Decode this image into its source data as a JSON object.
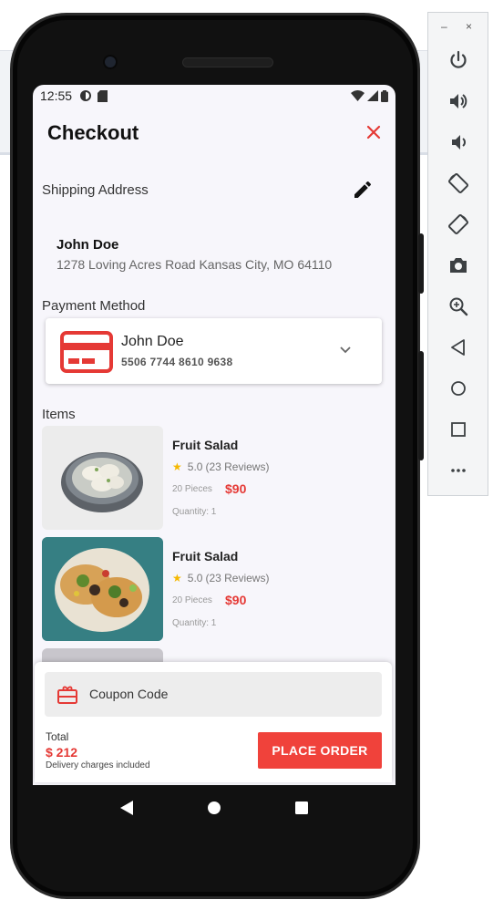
{
  "status_bar": {
    "time": "12:55"
  },
  "header": {
    "title": "Checkout"
  },
  "shipping": {
    "label": "Shipping Address",
    "name": "John Doe",
    "address": "1278 Loving Acres Road Kansas City, MO 64110"
  },
  "payment": {
    "label": "Payment Method",
    "holder": "John Doe",
    "card_number": "5506 7744 8610 9638"
  },
  "items": {
    "label": "Items",
    "list": [
      {
        "name": "Fruit Salad",
        "rating": "5.0",
        "reviews": "(23 Reviews)",
        "pieces": "20 Pieces",
        "price": "$90",
        "quantity": "Quantity: 1"
      },
      {
        "name": "Fruit Salad",
        "rating": "5.0",
        "reviews": "(23 Reviews)",
        "pieces": "20 Pieces",
        "price": "$90",
        "quantity": "Quantity: 1"
      }
    ]
  },
  "coupon": {
    "label": "Coupon Code"
  },
  "summary": {
    "total_label": "Total",
    "total_value": "$ 212",
    "note": "Delivery charges included",
    "place_order": "PLACE ORDER"
  },
  "colors": {
    "accent": "#e53935",
    "button": "#f0423b",
    "star": "#f5b800",
    "screen_bg": "#f7f6fb"
  },
  "emulator_toolbar": {
    "window_controls": [
      "–",
      "×"
    ],
    "tools": [
      "power-icon",
      "volume-up-icon",
      "volume-down-icon",
      "rotate-left-icon",
      "rotate-right-icon",
      "camera-icon",
      "zoom-icon",
      "back-icon",
      "home-icon",
      "overview-icon",
      "more-icon"
    ]
  }
}
